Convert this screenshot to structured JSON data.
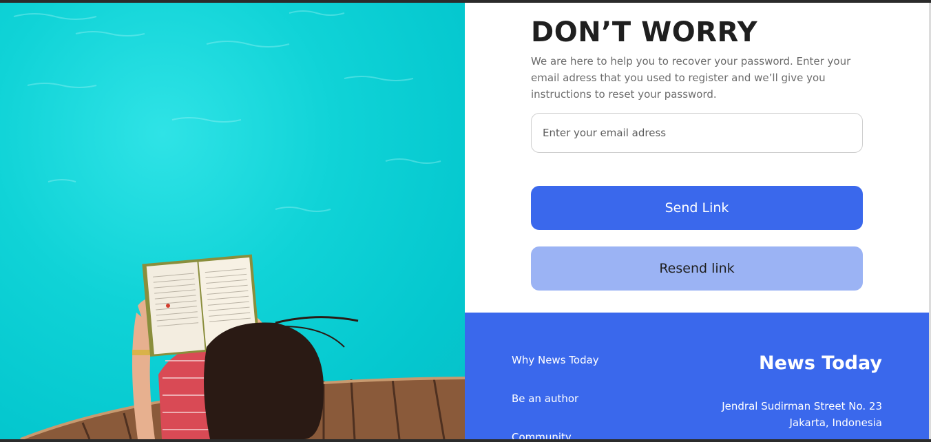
{
  "hero": {
    "image": "woman-reading-book-on-pool-deck"
  },
  "form": {
    "title": "DON’T WORRY",
    "description": "We are here to help you to recover your password. Enter your email adress that you used to register and we’ll give you instructions to reset your password.",
    "email_placeholder": "Enter your email adress",
    "email_value": "",
    "send_label": "Send Link",
    "resend_label": "Resend link"
  },
  "footer": {
    "links": [
      "Why News Today",
      "Be an author",
      "Community"
    ],
    "brand": "News Today",
    "address_line1": "Jendral Sudirman Street No. 23",
    "address_line2": "Jakarta, Indonesia"
  },
  "colors": {
    "accent": "#3a68ec",
    "accent_light": "#9bb3f4",
    "water": "#10d3d7"
  }
}
